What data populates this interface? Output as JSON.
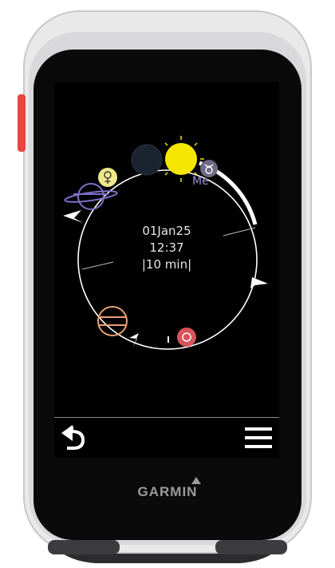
{
  "screen": {
    "date": "01Jan25",
    "time": "12:37",
    "interval": "|10 min|"
  },
  "planets": [
    {
      "name": "sun-icon",
      "color": "#f5e600"
    },
    {
      "name": "new-moon-icon",
      "color": "#1b2330"
    },
    {
      "name": "mercury-icon",
      "color": "#6e6a86",
      "label": "Me"
    },
    {
      "name": "venus-icon",
      "color": "#eee88a"
    },
    {
      "name": "saturn-icon",
      "color": "#7c6fc6"
    },
    {
      "name": "jupiter-icon",
      "color": "#e9a070"
    },
    {
      "name": "mars-icon",
      "color": "#d9525c"
    }
  ],
  "toolbar": {
    "back_icon": "back-arrow-icon",
    "menu_icon": "hamburger-menu-icon"
  },
  "device": {
    "brand": "GARMIN",
    "accent": "#e8463f"
  }
}
